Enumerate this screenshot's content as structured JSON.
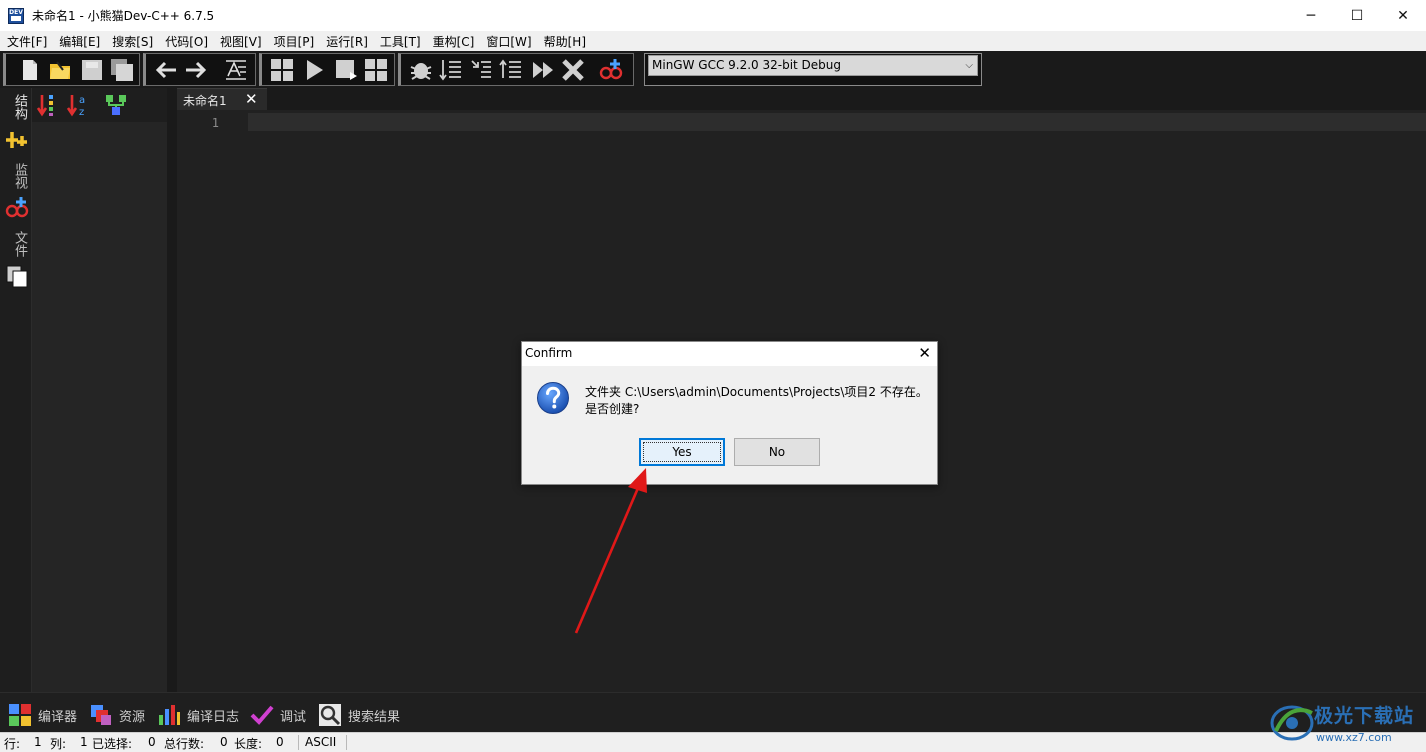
{
  "window": {
    "title": "未命名1 - 小熊猫Dev-C++ 6.7.5",
    "minimize": "─",
    "maximize": "☐",
    "close": "✕"
  },
  "menu": {
    "items": [
      "文件[F]",
      "编辑[E]",
      "搜索[S]",
      "代码[O]",
      "视图[V]",
      "项目[P]",
      "运行[R]",
      "工具[T]",
      "重构[C]",
      "窗口[W]",
      "帮助[H]"
    ]
  },
  "toolbar": {
    "compiler": "MinGW GCC 9.2.0 32-bit Debug",
    "dropdown_arrow": "⌵"
  },
  "left_panel": {
    "tabs": [
      "结构",
      "监视",
      "文件"
    ]
  },
  "editor": {
    "tab_label": "未命名1",
    "tab_close": "✕",
    "line_number": "1"
  },
  "bottom_tabs": [
    "编译器",
    "资源",
    "编译日志",
    "调试",
    "搜索结果"
  ],
  "status": {
    "row_label": "行:",
    "row_value": "1",
    "col_label": "列:",
    "col_value": "1",
    "sel_label": "已选择:",
    "sel_value": "0",
    "lines_label": "总行数:",
    "lines_value": "0",
    "len_label": "长度:",
    "len_value": "0",
    "encoding": "ASCII"
  },
  "dialog": {
    "title": "Confirm",
    "close": "✕",
    "message_line1": "文件夹 C:\\Users\\admin\\Documents\\Projects\\项目2 不存在。",
    "message_line2": "是否创建?",
    "yes_label": "Yes",
    "no_label": "No"
  },
  "watermark": {
    "text": "极光下载站",
    "url": "www.xz7.com"
  },
  "colors": {
    "arrow": "#e01818",
    "accent": "#0078d7"
  }
}
